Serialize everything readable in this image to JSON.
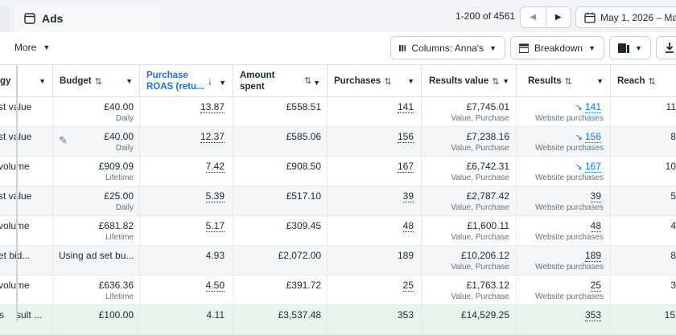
{
  "tabs": {
    "ads_label": "Ads"
  },
  "pagination": {
    "range": "1-200 of 4561",
    "prev_icon": "‹",
    "next_icon": "›"
  },
  "date_range": {
    "label": "May 1, 2026 – May"
  },
  "toolbar": {
    "more_label": "More",
    "columns_label": "Columns: Anna's",
    "breakdown_label": "Breakdown"
  },
  "columns": {
    "strategy": "gy",
    "budget": "Budget",
    "roas_line1": "Purchase",
    "roas_line2": "ROAS (retu...",
    "amount_line1": "Amount",
    "amount_line2": "spent",
    "purchases": "Purchases",
    "results_value": "Results value",
    "results": "Results",
    "reach": "Reach"
  },
  "rows": [
    {
      "strategy": "st value",
      "budget": "£40.00",
      "budget_sub": "Daily",
      "roas": "13.87",
      "amount": "£558.51",
      "purchases": "141",
      "rv": "£7,745.01",
      "rv_sub": "Value, Purchase",
      "results": "141",
      "results_sub": "Website purchases",
      "reach": "11",
      "trend": true
    },
    {
      "strategy": "st value",
      "budget": "£40.00",
      "budget_sub": "Daily",
      "roas": "12.37",
      "amount": "£585.06",
      "purchases": "156",
      "rv": "£7,238.16",
      "rv_sub": "Value, Purchase",
      "results": "156",
      "results_sub": "Website purchases",
      "reach": "8",
      "trend": true
    },
    {
      "strategy": "volume",
      "budget": "£909.09",
      "budget_sub": "Lifetime",
      "roas": "7.42",
      "amount": "£908.50",
      "purchases": "167",
      "rv": "£6,742.31",
      "rv_sub": "Value, Purchase",
      "results": "167",
      "results_sub": "Website purchases",
      "reach": "10",
      "trend": true
    },
    {
      "strategy": "st value",
      "budget": "£25.00",
      "budget_sub": "Daily",
      "roas": "5.39",
      "amount": "£517.10",
      "purchases": "39",
      "rv": "£2,787.42",
      "rv_sub": "Value, Purchase",
      "results": "39",
      "results_sub": "Website purchases",
      "reach": "5",
      "trend": false
    },
    {
      "strategy": "volume",
      "budget": "£681.82",
      "budget_sub": "Lifetime",
      "roas": "5.17",
      "amount": "£309.45",
      "purchases": "48",
      "rv": "£1,600.11",
      "rv_sub": "Value, Purchase",
      "results": "48",
      "results_sub": "Website purchases",
      "reach": "4",
      "trend": false
    },
    {
      "strategy": "et bid...",
      "budget": "Using ad set bu...",
      "budget_sub": "",
      "roas": "4.93",
      "amount": "£2,072.00",
      "purchases": "189",
      "rv": "£10,206.12",
      "rv_sub": "Value, Purchase",
      "results": "189",
      "results_sub": "Website purchases",
      "reach": "8",
      "trend": false
    },
    {
      "strategy": "volume",
      "budget": "£636.36",
      "budget_sub": "Lifetime",
      "roas": "4.50",
      "amount": "£391.72",
      "purchases": "25",
      "rv": "£1,763.12",
      "rv_sub": "Value, Purchase",
      "results": "25",
      "results_sub": "Website purchases",
      "reach": "3",
      "trend": false
    }
  ],
  "total_row": {
    "left": "s",
    "strategy": "sult ...",
    "budget": "£100.00",
    "roas": "4.11",
    "amount": "£3,537.48",
    "purchases": "353",
    "rv": "£14,529.25",
    "results": "353",
    "reach": "15"
  },
  "colors": {
    "accent": "#1a73d9",
    "total_bg": "#e6f4ec"
  }
}
